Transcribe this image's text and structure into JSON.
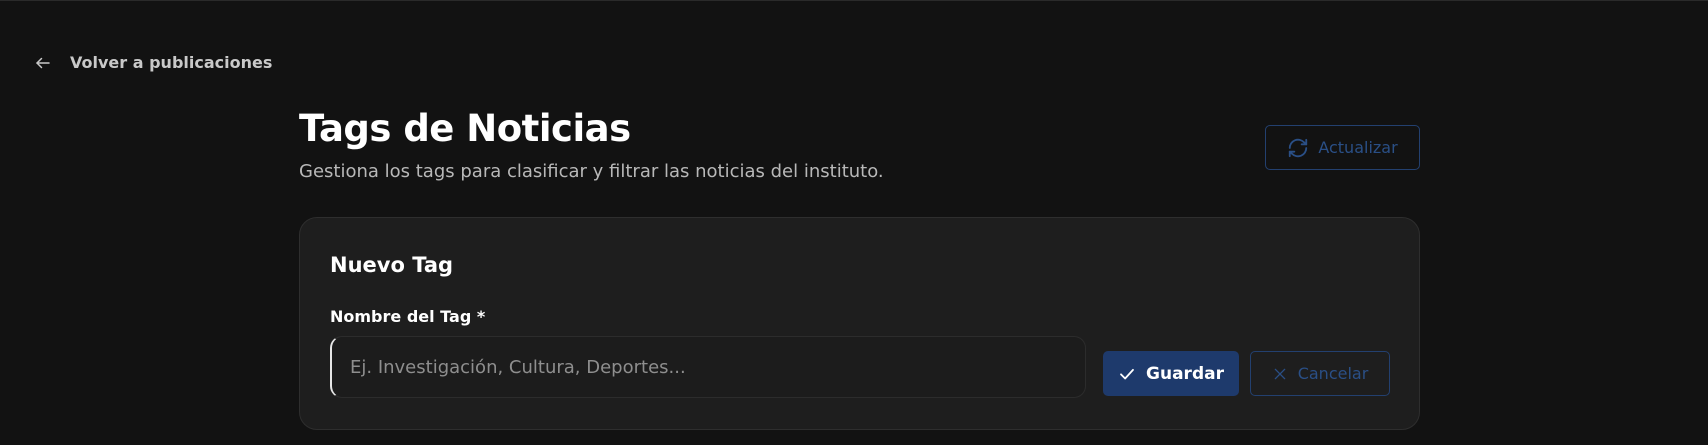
{
  "nav": {
    "back_label": "Volver a publicaciones"
  },
  "header": {
    "title": "Tags de Noticias",
    "subtitle": "Gestiona los tags para clasificar y filtrar las noticias del instituto.",
    "refresh_label": "Actualizar"
  },
  "form": {
    "title": "Nuevo Tag",
    "name_label": "Nombre del Tag *",
    "name_value": "",
    "name_placeholder": "Ej. Investigación, Cultura, Deportes...",
    "save_label": "Guardar",
    "cancel_label": "Cancelar"
  },
  "icons": {
    "back": "arrow-left-icon",
    "refresh": "refresh-icon",
    "save": "check-icon",
    "cancel": "close-icon"
  },
  "colors": {
    "background": "#121212",
    "card": "#1e1e1e",
    "primary": "#1e3a6c",
    "outline_accent": "#23406f",
    "muted_text": "#b8b8b8"
  }
}
